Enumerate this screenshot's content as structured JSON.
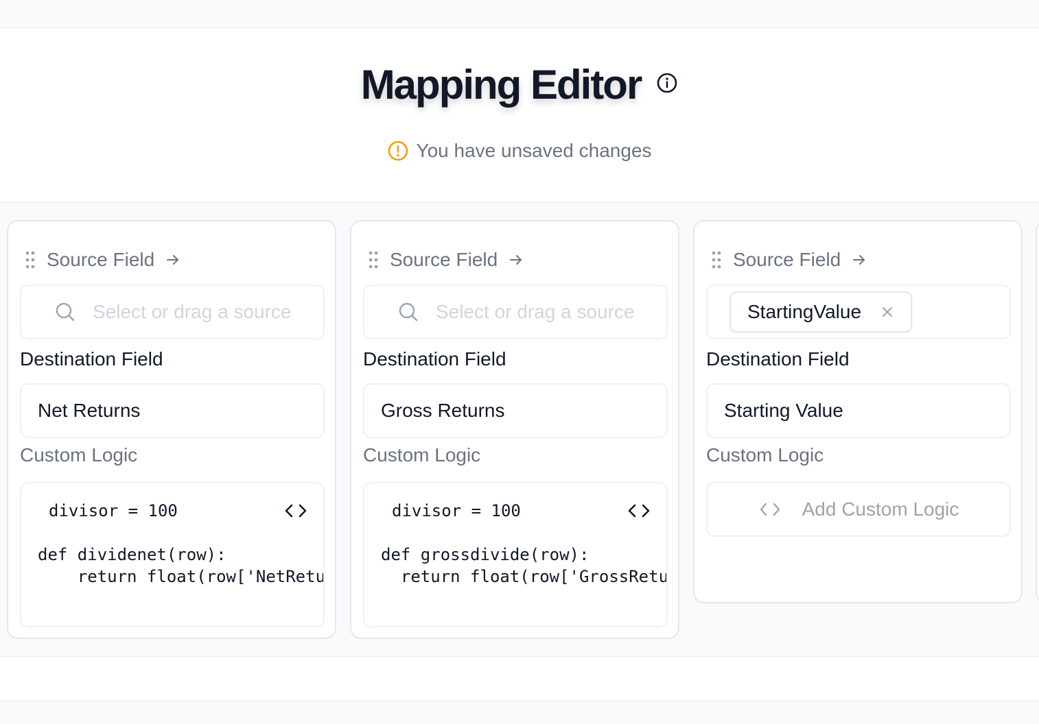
{
  "header": {
    "title": "Mapping Editor",
    "info_icon": "info-circle-icon",
    "unsaved_text": "You have unsaved changes",
    "warning_icon": "alert-circle-icon",
    "warning_color": "#f59e0b"
  },
  "cards": [
    {
      "source_label": "Source Field",
      "source_placeholder": "Select or drag a source field",
      "source_value": "",
      "destination_label": "Destination Field",
      "destination_value": "Net Returns",
      "logic_label": "Custom Logic",
      "code_lines": [
        "divisor = 100",
        "",
        "def dividenet(row):",
        "    return float(row['NetReturns']) / divisor"
      ]
    },
    {
      "source_label": "Source Field",
      "source_placeholder": "Select or drag a source field",
      "source_value": "",
      "destination_label": "Destination Field",
      "destination_value": "Gross Returns",
      "logic_label": "Custom Logic",
      "code_lines": [
        "divisor = 100",
        "",
        "def grossdivide(row):",
        "  return float(row['GrossReturns']) / divisor"
      ]
    },
    {
      "source_label": "Source Field",
      "source_value": "StartingValue",
      "destination_label": "Destination Field",
      "destination_value": "Starting Value",
      "logic_label": "Custom Logic",
      "add_logic_label": "Add Custom Logic"
    }
  ]
}
